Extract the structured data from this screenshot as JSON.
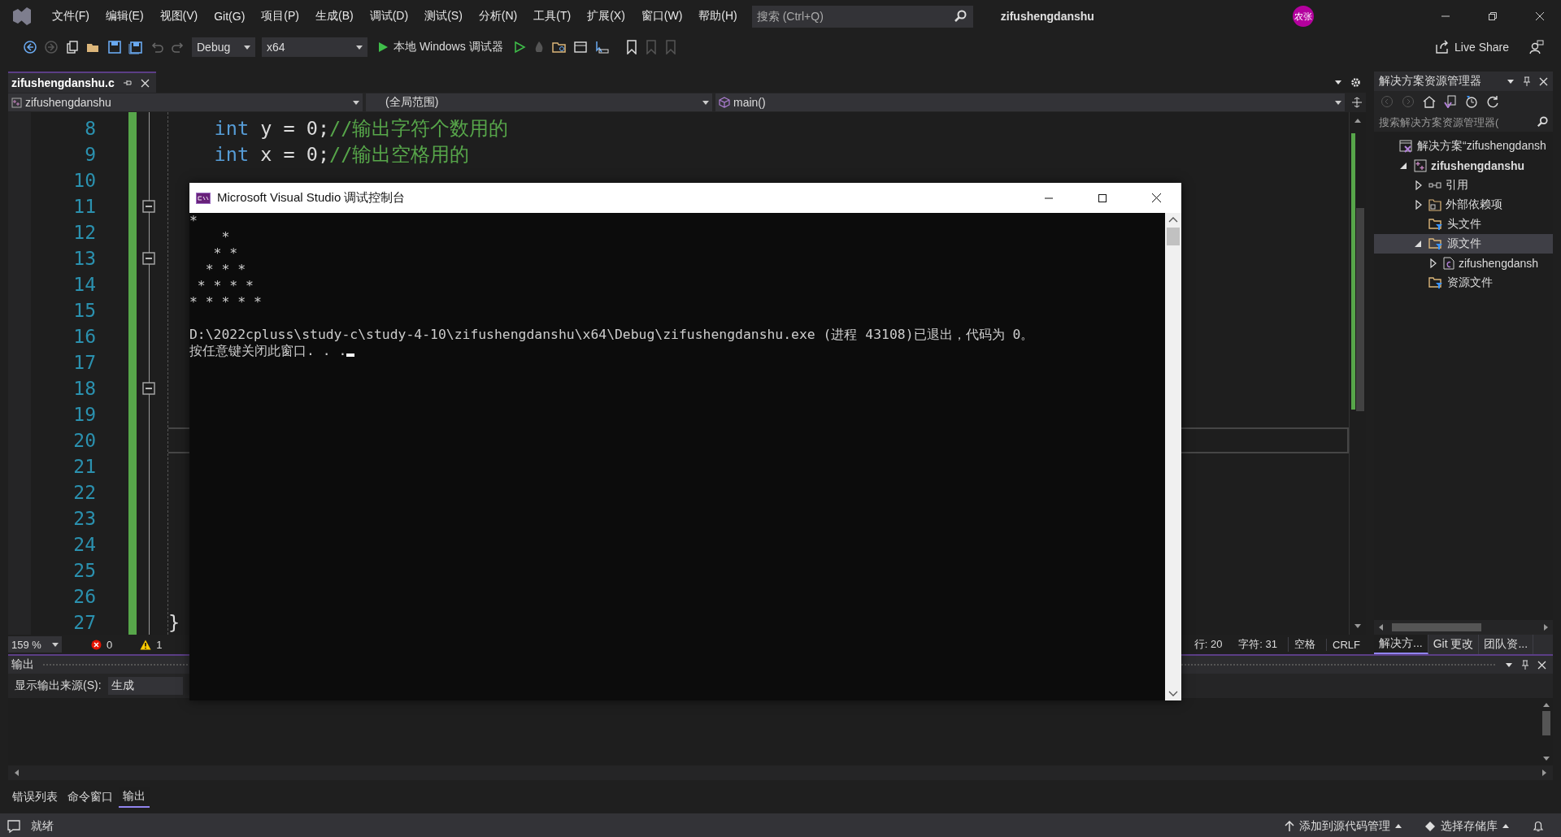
{
  "title_bar": {
    "menu": [
      "文件(F)",
      "编辑(E)",
      "视图(V)",
      "Git(G)",
      "项目(P)",
      "生成(B)",
      "调试(D)",
      "测试(S)",
      "分析(N)",
      "工具(T)",
      "扩展(X)",
      "窗口(W)",
      "帮助(H)"
    ],
    "search": {
      "placeholder": "搜索 (Ctrl+Q)"
    },
    "title": "zifushengdanshu",
    "avatar": "农张"
  },
  "toolbar": {
    "configuration": "Debug",
    "platform": "x64",
    "run": "本地 Windows 调试器",
    "live_share": "Live Share"
  },
  "document_tab": {
    "label": "zifushengdanshu.c"
  },
  "navigation_bar": {
    "project": "zifushengdanshu",
    "scope": "(全局范围)",
    "member": "main()"
  },
  "editor": {
    "lines": [
      {
        "number": "8",
        "fold": false,
        "current": false,
        "tokens": [
          {
            "kind": "keyword",
            "text": "    int"
          },
          {
            "kind": "plain",
            "text": " y = 0;"
          },
          {
            "kind": "comment",
            "text": "//输出字符个数用的"
          }
        ]
      },
      {
        "number": "9",
        "fold": false,
        "current": false,
        "tokens": [
          {
            "kind": "keyword",
            "text": "    int"
          },
          {
            "kind": "plain",
            "text": " x = 0;"
          },
          {
            "kind": "comment",
            "text": "//输出空格用的"
          }
        ]
      },
      {
        "number": "10",
        "fold": false,
        "current": false
      },
      {
        "number": "11",
        "fold": true,
        "current": false
      },
      {
        "number": "12",
        "fold": false,
        "current": false
      },
      {
        "number": "13",
        "fold": true,
        "current": false
      },
      {
        "number": "14",
        "fold": false,
        "current": false
      },
      {
        "number": "15",
        "fold": false,
        "current": false
      },
      {
        "number": "16",
        "fold": false,
        "current": false
      },
      {
        "number": "17",
        "fold": false,
        "current": false
      },
      {
        "number": "18",
        "fold": true,
        "current": false
      },
      {
        "number": "19",
        "fold": false,
        "current": false
      },
      {
        "number": "20",
        "fold": false,
        "current": true
      },
      {
        "number": "21",
        "fold": false,
        "current": false
      },
      {
        "number": "22",
        "fold": false,
        "current": false
      },
      {
        "number": "23",
        "fold": false,
        "current": false
      },
      {
        "number": "24",
        "fold": false,
        "current": false
      },
      {
        "number": "25",
        "fold": false,
        "current": false
      },
      {
        "number": "26",
        "fold": false,
        "current": false
      },
      {
        "number": "27",
        "fold": false,
        "current": false,
        "tokens": [
          {
            "kind": "plain",
            "text": "}"
          }
        ]
      }
    ]
  },
  "editor_status": {
    "zoom": "159 %",
    "errors": "0",
    "warnings": "1",
    "line": "行: 20",
    "column": "字符: 31",
    "indent": "空格",
    "line_ending": "CRLF"
  },
  "solution_explorer": {
    "title": "解决方案资源管理器",
    "search": {
      "placeholder": "搜索解决方案资源管理器("
    },
    "tree": [
      {
        "label": "解决方案“zifushengdansh",
        "kind": "solution",
        "selected": false,
        "children": [
          {
            "label": "zifushengdanshu",
            "kind": "project",
            "expanded": true,
            "selected": false,
            "children": [
              {
                "label": "引用",
                "kind": "references",
                "expanded": false,
                "selected": false
              },
              {
                "label": "外部依赖项",
                "kind": "dependencies",
                "expanded": false,
                "selected": false
              },
              {
                "label": "头文件",
                "kind": "folder",
                "selected": false
              },
              {
                "label": "源文件",
                "kind": "folder",
                "expanded": true,
                "selected": true,
                "children": [
                  {
                    "label": "zifushengdansh",
                    "kind": "file",
                    "expanded": false,
                    "selected": false
                  }
                ]
              },
              {
                "label": "资源文件",
                "kind": "folder",
                "selected": false
              }
            ]
          }
        ]
      }
    ],
    "tabs": [
      {
        "label": "解决方...",
        "selected": true
      },
      {
        "label": "Git 更改",
        "selected": false
      },
      {
        "label": "团队资...",
        "selected": false
      }
    ]
  },
  "output": {
    "title": "输出",
    "source_label": "显示输出来源(S):",
    "source": "生成"
  },
  "bottom_tabs": [
    {
      "label": "错误列表",
      "selected": false
    },
    {
      "label": "命令窗口",
      "selected": false
    },
    {
      "label": "输出",
      "selected": true
    }
  ],
  "status_bar": {
    "ready": "就绪",
    "source_control": "添加到源代码管理",
    "repository": "选择存储库"
  },
  "console": {
    "title": "Microsoft Visual Studio 调试控制台",
    "program_output": "*\n    *\n   * *\n  * * *\n * * * *\n* * * * *",
    "messages": [
      "D:\\2022cpluss\\study-c\\study-4-10\\zifushengdanshu\\x64\\Debug\\zifushengdanshu.exe (进程 43108)已退出，代码为 0。",
      "按任意键关闭此窗口. . ."
    ]
  }
}
